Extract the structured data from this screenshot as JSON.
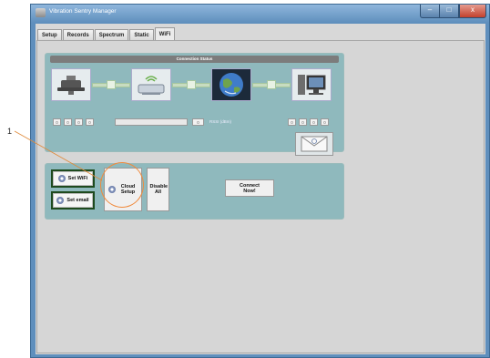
{
  "window": {
    "title": "Vibration Sentry Manager",
    "controls": {
      "minimize": "–",
      "maximize": "□",
      "close": "x"
    }
  },
  "tabs": [
    {
      "label": "Setup",
      "active": false
    },
    {
      "label": "Records",
      "active": false
    },
    {
      "label": "Spectrum",
      "active": false
    },
    {
      "label": "Static",
      "active": false
    },
    {
      "label": "WiFi",
      "active": true
    }
  ],
  "connection_status": {
    "header": "Connection Status",
    "sensor_ip": [
      "0",
      "0",
      "0",
      "0"
    ],
    "server_ip": [
      "0",
      "0",
      "0",
      "0"
    ],
    "ssid_value": "",
    "rssi_value": "0",
    "rssi_label": "RSSI (dBm)",
    "icons": [
      "sensor-device-icon",
      "wifi-router-icon",
      "globe-icon",
      "computer-icon",
      "envelope-icon"
    ]
  },
  "actions": {
    "set_wifi": "Set WiFi",
    "set_email": "Set email",
    "cloud_setup": "Cloud Setup",
    "disable_all": "Disable All",
    "connect_now": "Connect Now!"
  },
  "annotation": {
    "callout_number": "1"
  },
  "colors": {
    "window_frame": "#5f8fbd",
    "group_bg": "#8fb9bd",
    "highlight_ring": "#f08a3c",
    "dark_button_border": "#1e4a1e"
  }
}
